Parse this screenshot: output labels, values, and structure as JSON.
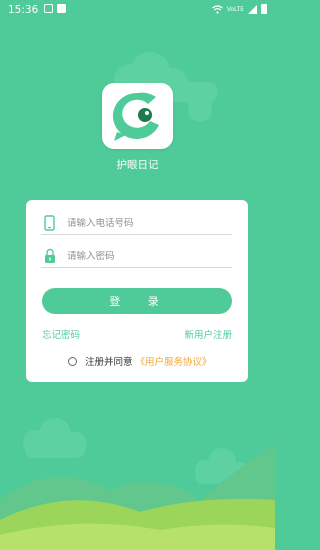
{
  "status_bar": {
    "time": "15:36",
    "network": "VoLTE"
  },
  "app": {
    "name": "护眼日记"
  },
  "login": {
    "phone_placeholder": "请输入电话号码",
    "password_placeholder": "请输入密码",
    "login_label": "登 录",
    "forgot_password": "忘记密码",
    "register": "新用户注册",
    "agree_text": "注册并同意",
    "agreement_link": "《用户服务协议》"
  },
  "colors": {
    "accent": "#4ecb98",
    "link": "#f2a735",
    "dark_green": "#2f8a5d"
  }
}
